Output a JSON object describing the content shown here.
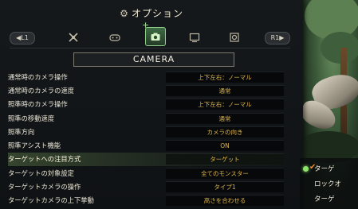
{
  "window": {
    "title": "オプション",
    "gear_icon": "gear-icon"
  },
  "nav": {
    "left_button": "L1",
    "right_button": "R1"
  },
  "tabs": [
    {
      "icon": "hunter-icon",
      "active": false
    },
    {
      "icon": "controller-icon",
      "active": false
    },
    {
      "icon": "camera-icon",
      "active": true
    },
    {
      "icon": "display-icon",
      "active": false
    },
    {
      "icon": "sound-icon",
      "active": false
    }
  ],
  "section": {
    "title": "CAMERA"
  },
  "settings": [
    {
      "label": "通常時のカメラ操作",
      "value": "上下左右：ノーマル"
    },
    {
      "label": "通常時のカメラの速度",
      "value": "通常"
    },
    {
      "label": "照準時のカメラ操作",
      "value": "上下左右：ノーマル"
    },
    {
      "label": "照準の移動速度",
      "value": "通常"
    },
    {
      "label": "照準方向",
      "value": "カメラの向き"
    },
    {
      "label": "照準アシスト機能",
      "value": "ON"
    },
    {
      "label": "ターゲットへの注目方式",
      "value": "ターゲット"
    },
    {
      "label": "ターゲットの対象設定",
      "value": "全てのモンスター"
    },
    {
      "label": "ターゲットカメラの操作",
      "value": "タイプ1"
    },
    {
      "label": "ターゲットカメラの上下挙動",
      "value": "高さを合わせる"
    }
  ],
  "selected_index": 6,
  "popup": {
    "items": [
      "ターゲ",
      "ロックオ",
      "ターゲ"
    ]
  },
  "colors": {
    "value_text": "#e0b64a",
    "accent_green": "#8ee36a"
  }
}
